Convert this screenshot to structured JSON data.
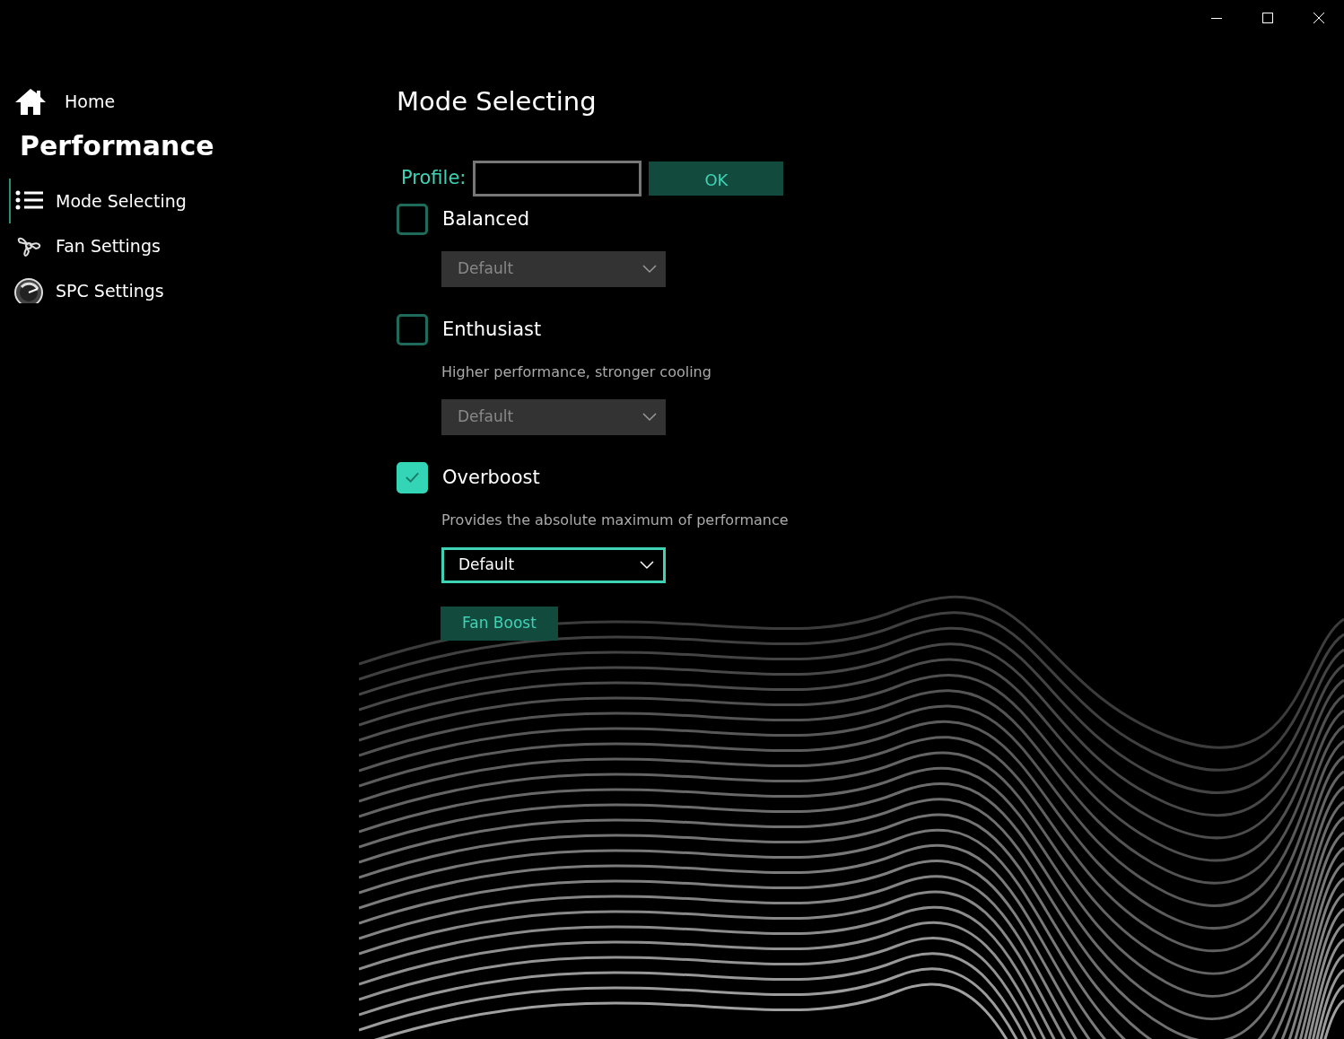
{
  "sidebar": {
    "home": "Home",
    "section": "Performance",
    "items": [
      {
        "label": "Mode Selecting",
        "selected": true
      },
      {
        "label": "Fan Settings",
        "selected": false
      },
      {
        "label": "SPC Settings",
        "selected": false
      }
    ]
  },
  "page_title": "Mode Selecting",
  "profile": {
    "label": "Profile:",
    "button": "OK"
  },
  "modes": [
    {
      "name": "Balanced",
      "checked": false,
      "dropdown": "Default"
    },
    {
      "name": "Enthusiast",
      "checked": false,
      "description": "Higher performance, stronger cooling",
      "dropdown": "Default"
    },
    {
      "name": "Overboost",
      "checked": true,
      "description": "Provides the absolute maximum of performance",
      "dropdown": "Default"
    }
  ],
  "fan_boost_button": "Fan Boost"
}
